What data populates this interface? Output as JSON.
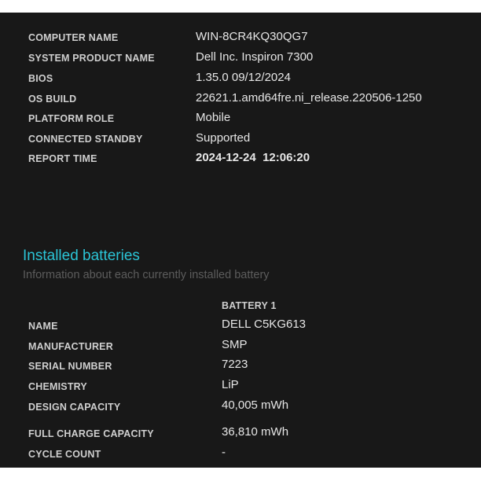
{
  "system_info": [
    {
      "label": "COMPUTER NAME",
      "value": "WIN-8CR4KQ30QG7"
    },
    {
      "label": "SYSTEM PRODUCT NAME",
      "value": "Dell Inc. Inspiron 7300"
    },
    {
      "label": "BIOS",
      "value": "1.35.0 09/12/2024"
    },
    {
      "label": "OS BUILD",
      "value": "22621.1.amd64fre.ni_release.220506-1250"
    },
    {
      "label": "PLATFORM ROLE",
      "value": "Mobile"
    },
    {
      "label": "CONNECTED STANDBY",
      "value": "Supported"
    },
    {
      "label": "REPORT TIME",
      "value": "2024-12-24  12:06:20"
    }
  ],
  "batteries": {
    "title": "Installed batteries",
    "subtitle": "Information about each currently installed battery",
    "column_header": "BATTERY 1",
    "rows": [
      {
        "label": "NAME",
        "value": "DELL C5KG613"
      },
      {
        "label": "MANUFACTURER",
        "value": "SMP"
      },
      {
        "label": "SERIAL NUMBER",
        "value": "7223"
      },
      {
        "label": "CHEMISTRY",
        "value": "LiP"
      },
      {
        "label": "DESIGN CAPACITY",
        "value": "40,005 mWh"
      },
      {
        "label": "FULL CHARGE CAPACITY",
        "value": "36,810 mWh"
      },
      {
        "label": "CYCLE COUNT",
        "value": "-"
      }
    ]
  },
  "colors": {
    "background": "#181818",
    "accent": "#2bc4d6"
  }
}
